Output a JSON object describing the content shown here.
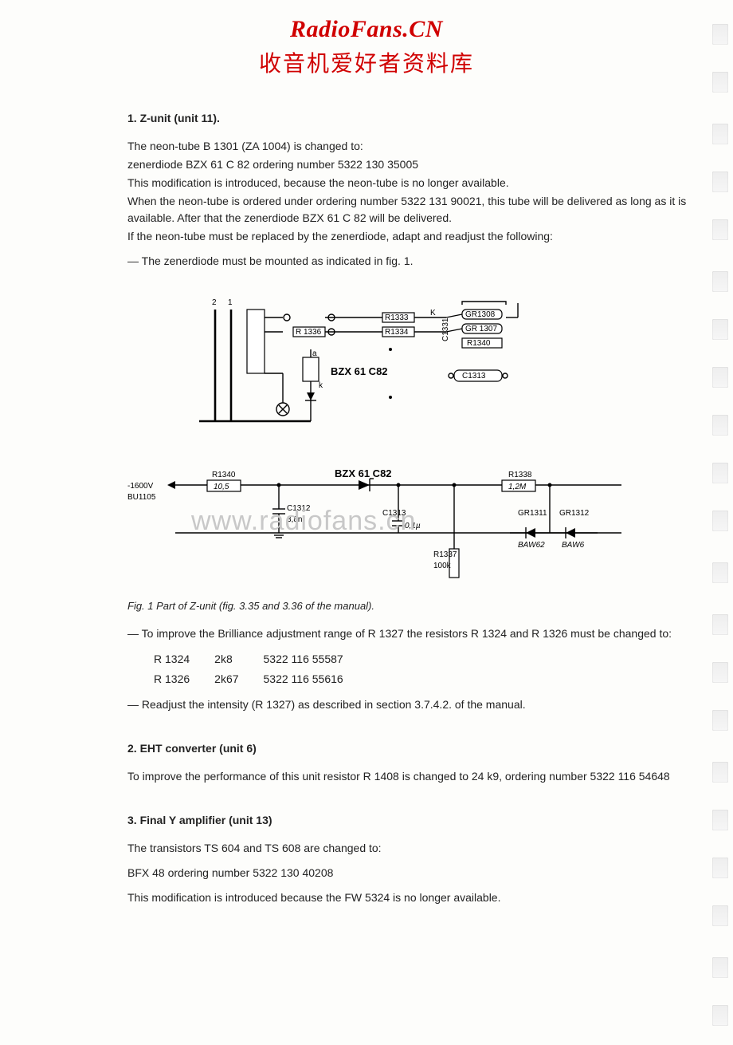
{
  "header": {
    "site": "RadioFans.CN",
    "cn": "收音机爱好者资料库"
  },
  "watermark": "www.radiofans.cn",
  "section1": {
    "title": "1. Z-unit (unit 11).",
    "p1": "The neon-tube B 1301 (ZA 1004) is changed to:",
    "p2": "zenerdiode BZX 61 C 82 ordering number 5322 130 35005",
    "p3": "This modification is introduced, because the neon-tube is no longer available.",
    "p4": "When the neon-tube is ordered under ordering number 5322 131 90021, this tube will be delivered as long as it is available. After that the zenerdiode BZX 61 C 82 will be delivered.",
    "p5": "If the neon-tube must be replaced by the zenerdiode, adapt and readjust the following:",
    "p6": "— The zenerdiode must be mounted as indicated in fig. 1."
  },
  "fig1": {
    "r1336": "R 1336",
    "r1333": "R1333",
    "r1334": "R1334",
    "gr1308": "GR1308",
    "gr1307": "GR 1307",
    "r1340_top": "R1340",
    "c1313_top": "C1313",
    "c1331": "C1331",
    "bzx": "BZX 61 C82",
    "pin_a": "a",
    "pin_k": "k",
    "pin_K": "K",
    "pins": [
      "1",
      "2"
    ]
  },
  "fig2": {
    "v_label1": "-1600V",
    "v_label2": "BU1105",
    "r1340": "R1340",
    "r1340v": "10,5",
    "c1312": "C1312",
    "c1312v": "3,8n",
    "bzx": "BZX 61 C82",
    "c1313": "C1313",
    "c1313v": "0,1µ",
    "r1337": "R1337",
    "r1337v": "100k",
    "r1338": "R1338",
    "r1338v": "1,2M",
    "gr1311": "GR1311",
    "gr1312": "GR1312",
    "baw62": "BAW62",
    "baw": "BAW6"
  },
  "caption1": "Fig. 1 Part of Z-unit (fig. 3.35 and 3.36 of the manual).",
  "after_fig": {
    "p1": "— To improve the Brilliance adjustment range of R 1327 the resistors R 1324 and R 1326 must be changed to:",
    "rows": [
      {
        "ref": "R 1324",
        "val": "2k8",
        "ord": "5322 116 55587"
      },
      {
        "ref": "R 1326",
        "val": "2k67",
        "ord": "5322 116 55616"
      }
    ],
    "p2": "— Readjust the intensity (R 1327) as described in section 3.7.4.2. of the manual."
  },
  "section2": {
    "title": "2. EHT converter (unit 6)",
    "p1": "To improve the performance of this unit resistor R 1408 is changed to 24 k9, ordering number 5322 116 54648"
  },
  "section3": {
    "title": "3. Final Y amplifier (unit 13)",
    "p1": "The transistors TS 604 and TS 608 are changed to:",
    "p2": "BFX 48 ordering number 5322 130 40208",
    "p3": "This modification is introduced because the FW 5324 is no longer available."
  }
}
